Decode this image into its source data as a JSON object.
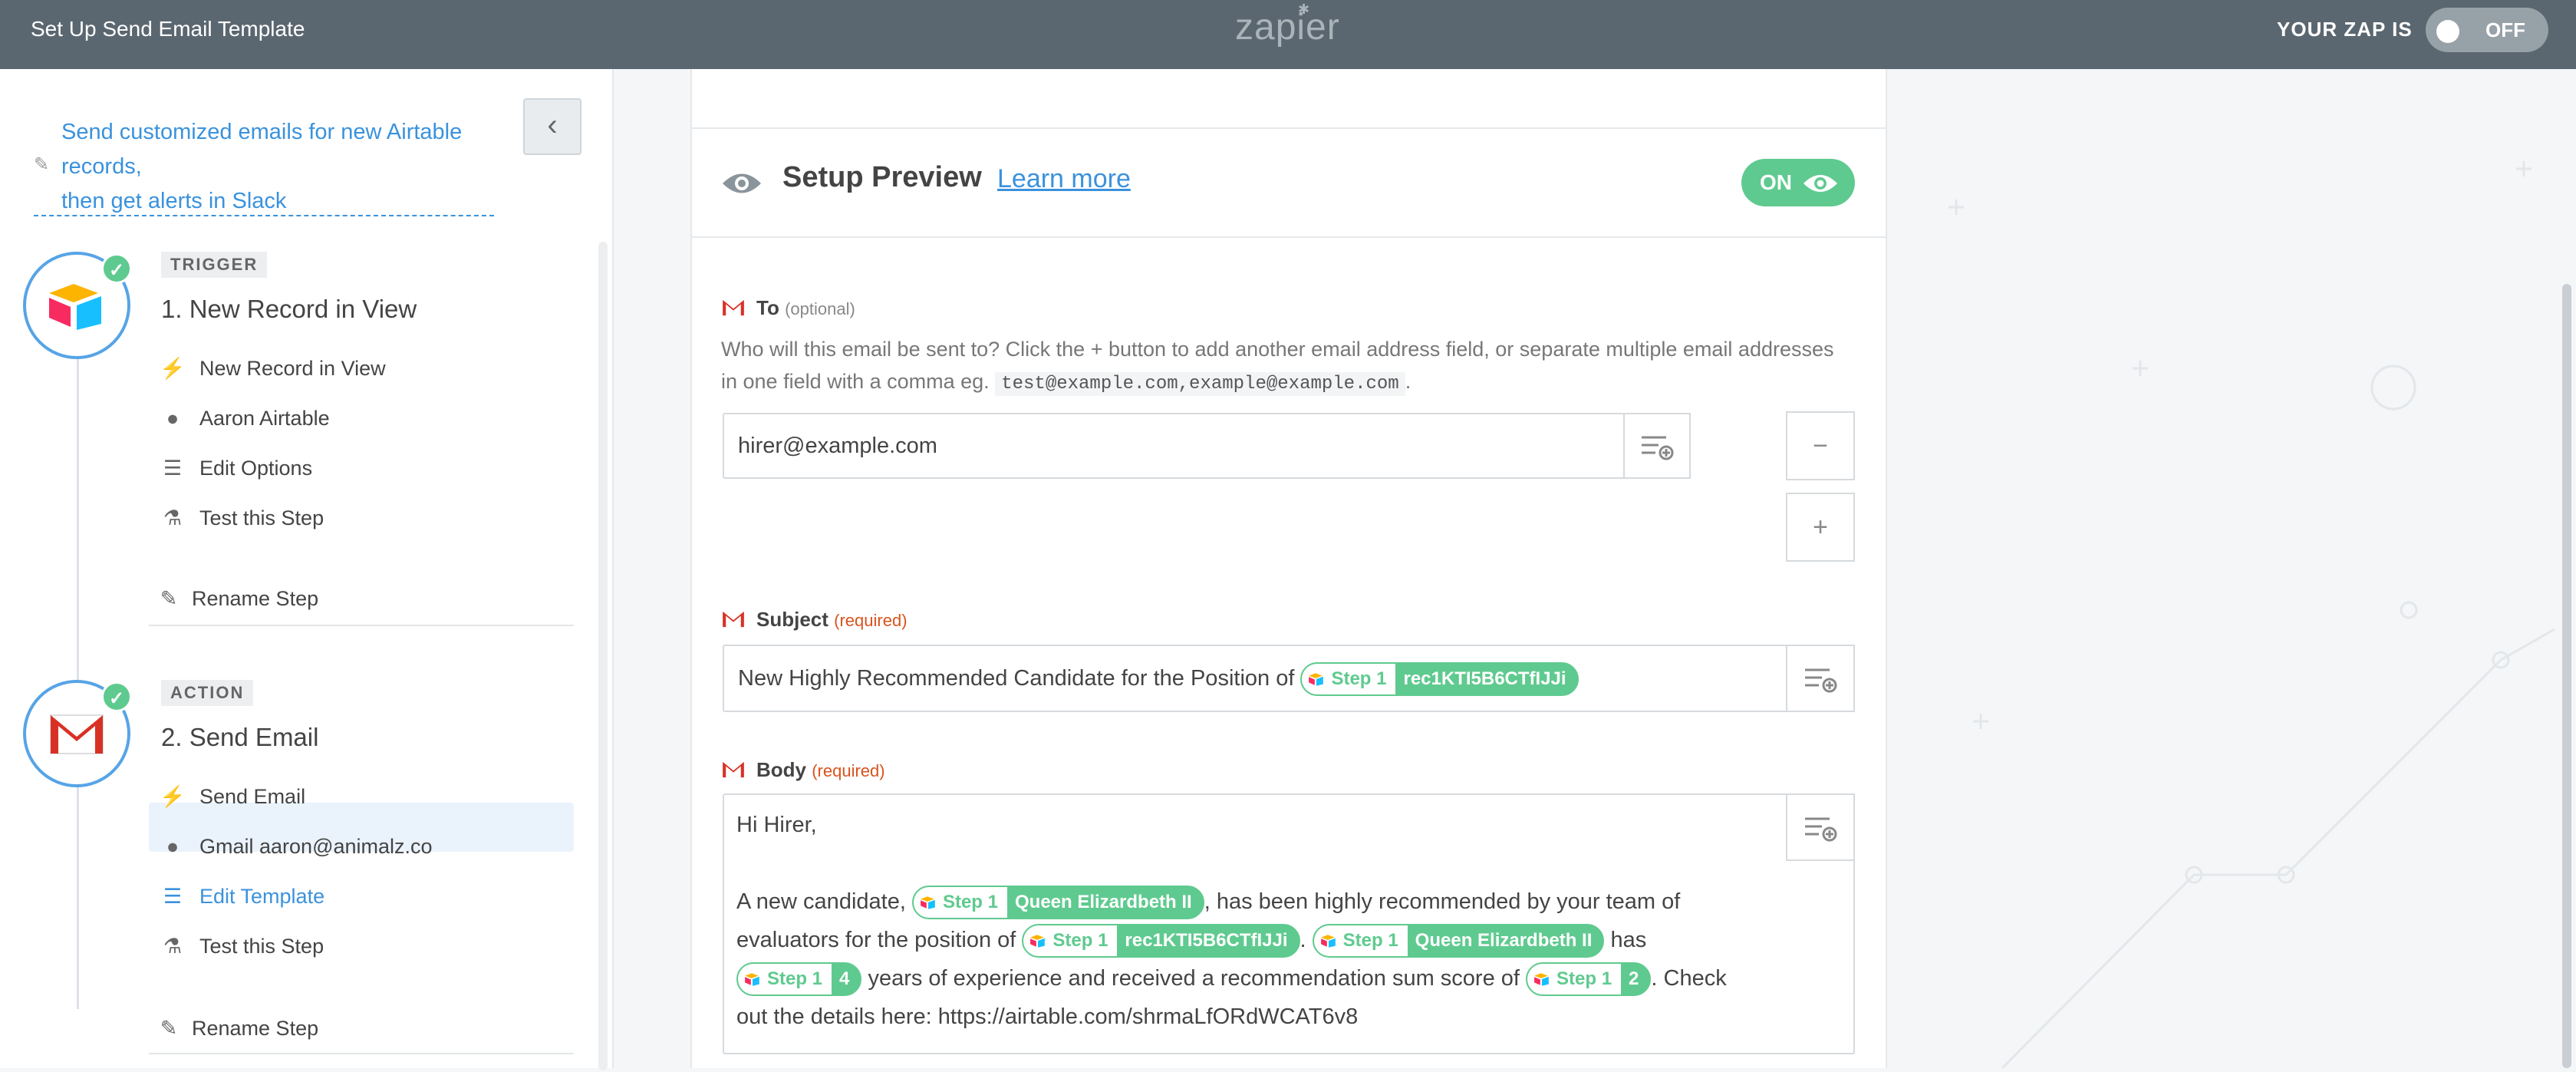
{
  "topbar": {
    "title": "Set Up Send Email Template",
    "logo": "zapier",
    "zap_status_label": "YOUR ZAP IS",
    "zap_toggle": "OFF"
  },
  "sidebar": {
    "zap_name_line1": "Send customized emails for new Airtable",
    "zap_name_line2": "records,",
    "zap_name_line3": "then get alerts in Slack",
    "trigger": {
      "tag": "TRIGGER",
      "name": "1. New Record in View",
      "items": [
        {
          "icon": "bolt-icon",
          "label": "New Record in View"
        },
        {
          "icon": "user-icon",
          "label": "Aaron Airtable"
        },
        {
          "icon": "list-icon",
          "label": "Edit Options"
        },
        {
          "icon": "flask-icon",
          "label": "Test this Step"
        }
      ],
      "rename": "Rename Step"
    },
    "action": {
      "tag": "ACTION",
      "name": "2. Send Email",
      "items": [
        {
          "icon": "bolt-icon",
          "label": "Send Email"
        },
        {
          "icon": "user-icon",
          "label": "Gmail aaron@animalz.co"
        },
        {
          "icon": "list-icon",
          "label": "Edit Template"
        },
        {
          "icon": "flask-icon",
          "label": "Test this Step"
        }
      ],
      "rename": "Rename Step"
    }
  },
  "main": {
    "setup_title": "Setup Preview",
    "learn_more": "Learn more",
    "preview_toggle": "ON",
    "to": {
      "label": "To",
      "qualifier": "(optional)",
      "help_text_1": "Who will this email be sent to? Click the + button to add another email address field, or separate multiple email addresses",
      "help_text_2": "in one field with a comma eg.",
      "help_code": "test@example.com,example@example.com",
      "help_end": ".",
      "value": "hirer@example.com"
    },
    "subject": {
      "label": "Subject",
      "qualifier": "(required)",
      "text": "New Highly Recommended Candidate for the Position of",
      "pill_step": "Step 1",
      "pill_value": "rec1KTI5B6CTfIJJi"
    },
    "body": {
      "label": "Body",
      "qualifier": "(required)",
      "greeting": "Hi Hirer,",
      "p1": "A new candidate,",
      "pill1_step": "Step 1",
      "pill1_value": "Queen Elizardbeth II",
      "p2": ", has been highly recommended by your team of",
      "p3": "evaluators for the position of",
      "pill2_step": "Step 1",
      "pill2_value": "rec1KTI5B6CTfIJJi",
      "p4": ".",
      "pill3_step": "Step 1",
      "pill3_value": "Queen Elizardbeth II",
      "p5": "has",
      "pill4_step": "Step 1",
      "pill4_value": "4",
      "p6": "years of experience and received a recommendation sum score of",
      "pill5_step": "Step 1",
      "pill5_value": "2",
      "p7": ". Check",
      "p8": "out the details here: https://airtable.com/shrmaLfORdWCAT6v8"
    }
  }
}
